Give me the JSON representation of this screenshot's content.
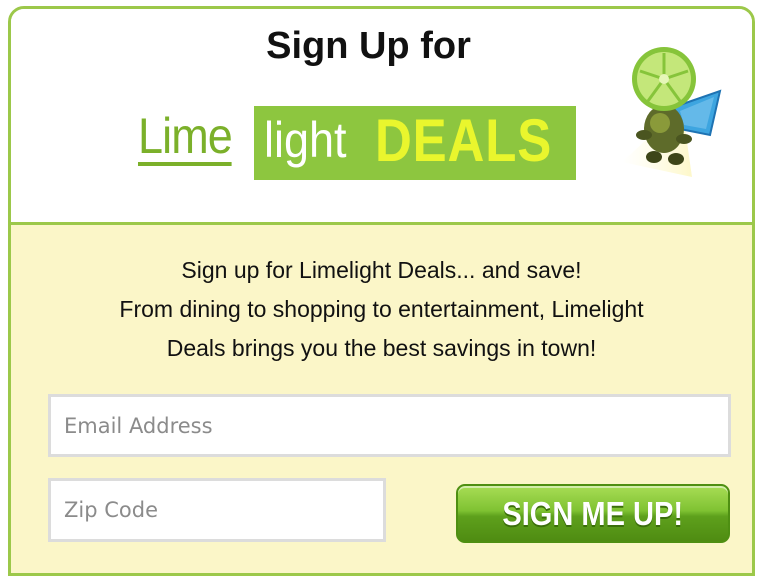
{
  "header": {
    "title": "Sign Up for",
    "logo": {
      "word1": "Lime",
      "word2": "light",
      "word3": "DEALS"
    },
    "mascot_icon": "lime-mascot-icon"
  },
  "promo": {
    "line1": "Sign up for Limelight Deals... and save!",
    "line2": "From dining to shopping to entertainment, Limelight",
    "line3": "Deals brings you the best savings in town!"
  },
  "form": {
    "email_placeholder": "Email Address",
    "email_value": "",
    "zip_placeholder": "Zip Code",
    "zip_value": "",
    "submit_label": "SIGN ME UP!"
  },
  "colors": {
    "accent_green": "#8dc63f",
    "border_green": "#9cc84a",
    "form_background": "#fbf6c8",
    "deals_yellow": "#e9f62d"
  }
}
